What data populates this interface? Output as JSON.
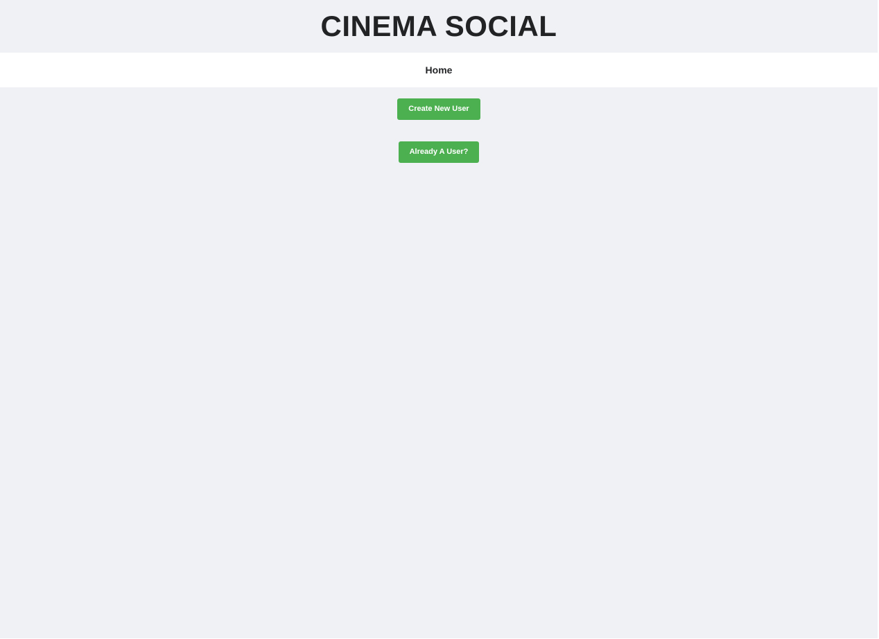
{
  "header": {
    "title": "CINEMA SOCIAL"
  },
  "nav": {
    "home_label": "Home"
  },
  "main": {
    "create_user_label": "Create New User",
    "existing_user_label": "Already A User?"
  },
  "colors": {
    "background": "#f0f1f5",
    "nav_background": "#ffffff",
    "text": "#222325",
    "button_green": "#4caf50",
    "button_text": "#ffffff"
  }
}
